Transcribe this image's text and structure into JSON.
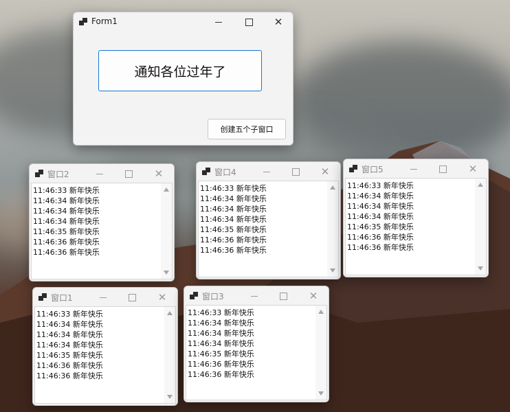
{
  "form1": {
    "title": "Form1",
    "notify_button": "通知各位过年了",
    "create_button": "创建五个子窗口"
  },
  "child_windows": [
    {
      "title": "窗口2",
      "lines": [
        "11:46:33 新年快乐",
        "11:46:34 新年快乐",
        "11:46:34 新年快乐",
        "11:46:34 新年快乐",
        "11:46:35 新年快乐",
        "11:46:36 新年快乐",
        "11:46:36 新年快乐"
      ]
    },
    {
      "title": "窗口4",
      "lines": [
        "11:46:33 新年快乐",
        "11:46:34 新年快乐",
        "11:46:34 新年快乐",
        "11:46:34 新年快乐",
        "11:46:35 新年快乐",
        "11:46:36 新年快乐",
        "11:46:36 新年快乐"
      ]
    },
    {
      "title": "窗口5",
      "lines": [
        "11:46:33 新年快乐",
        "11:46:34 新年快乐",
        "11:46:34 新年快乐",
        "11:46:34 新年快乐",
        "11:46:35 新年快乐",
        "11:46:36 新年快乐",
        "11:46:36 新年快乐"
      ]
    },
    {
      "title": "窗口1",
      "lines": [
        "11:46:33 新年快乐",
        "11:46:34 新年快乐",
        "11:46:34 新年快乐",
        "11:46:34 新年快乐",
        "11:46:35 新年快乐",
        "11:46:36 新年快乐",
        "11:46:36 新年快乐"
      ]
    },
    {
      "title": "窗口3",
      "lines": [
        "11:46:33 新年快乐",
        "11:46:34 新年快乐",
        "11:46:34 新年快乐",
        "11:46:34 新年快乐",
        "11:46:35 新年快乐",
        "11:46:36 新年快乐",
        "11:46:36 新年快乐"
      ]
    }
  ],
  "window_controls": {
    "minimize_icon": "minimize-icon",
    "maximize_icon": "maximize-icon",
    "close_icon": "close-icon"
  },
  "colors": {
    "button_accent_border": "#1976d2",
    "window_background": "#f3f3f3",
    "listbox_background": "#ffffff"
  }
}
